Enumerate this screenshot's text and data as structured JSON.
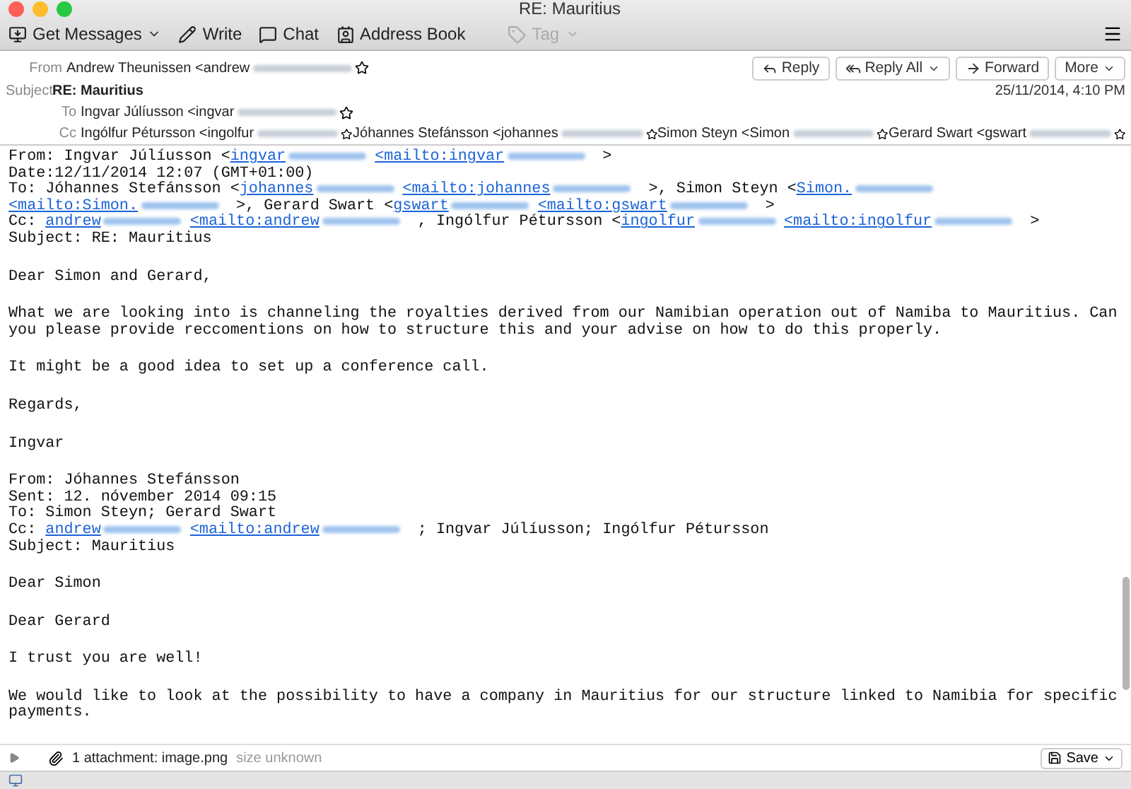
{
  "window": {
    "title": "RE: Mauritius"
  },
  "toolbar": {
    "buttons": [
      {
        "kind": "get",
        "label": "Get Messages",
        "disabled": false
      },
      {
        "kind": "write",
        "label": "Write",
        "disabled": false
      },
      {
        "kind": "chat",
        "label": "Chat",
        "disabled": false
      },
      {
        "kind": "contacts",
        "label": "Address Book",
        "disabled": false
      },
      {
        "kind": "tag",
        "label": "Tag",
        "disabled": true
      }
    ]
  },
  "header": {
    "actions": [
      {
        "kind": "reply",
        "label": "Reply"
      },
      {
        "kind": "replyall",
        "label": "Reply All"
      },
      {
        "kind": "forward",
        "label": "Forward"
      },
      {
        "kind": "more",
        "label": "More"
      }
    ],
    "date": "25/11/2014, 4:10 PM",
    "from": {
      "label": "From",
      "people": [
        {
          "text": "Andrew Theunissen <andrew"
        }
      ]
    },
    "subject": {
      "label": "Subject",
      "value": "RE: Mauritius"
    },
    "to": {
      "label": "To",
      "people": [
        {
          "text": "Ingvar Júlíusson <ingvar"
        }
      ]
    },
    "cc": {
      "label": "Cc",
      "people": [
        {
          "text": "Ingólfur Pétursson <ingolfur"
        },
        {
          "text": "Jóhannes Stefánsson <johannes"
        },
        {
          "text": "Simon Steyn <Simon"
        },
        {
          "text": "Gerard Swart <gswart"
        }
      ]
    }
  },
  "body": [
    {
      "lines": [
        [
          {
            "kind": "text",
            "text": "From: Ingvar Júlíusson <"
          },
          {
            "kind": "link",
            "text": "ingvar"
          },
          {
            "kind": "link",
            "text": "<mailto:ingvar"
          },
          {
            "kind": "text",
            "text": " >"
          }
        ],
        [
          {
            "kind": "text",
            "text": "Date:12/11/2014 12:07 (GMT+01:00)"
          }
        ],
        [
          {
            "kind": "text",
            "text": "To: Jóhannes Stefánsson <"
          },
          {
            "kind": "link",
            "text": "johannes"
          },
          {
            "kind": "link",
            "text": "<mailto:johannes"
          },
          {
            "kind": "text",
            "text": " >, Simon Steyn <"
          },
          {
            "kind": "link",
            "text": "Simon."
          }
        ],
        [
          {
            "kind": "link",
            "text": "<mailto:Simon."
          },
          {
            "kind": "text",
            "text": " >, Gerard Swart <"
          },
          {
            "kind": "link",
            "text": "gswart"
          },
          {
            "kind": "link",
            "text": "<mailto:gswart"
          },
          {
            "kind": "text",
            "text": " >"
          }
        ],
        [
          {
            "kind": "text",
            "text": "Cc: "
          },
          {
            "kind": "link",
            "text": "andrew"
          },
          {
            "kind": "link",
            "text": "<mailto:andrew"
          },
          {
            "kind": "text",
            "text": " , Ingólfur Pétursson <"
          },
          {
            "kind": "link",
            "text": "ingolfur"
          },
          {
            "kind": "link",
            "text": "<mailto:ingolfur"
          },
          {
            "kind": "text",
            "text": " >"
          }
        ],
        [
          {
            "kind": "text",
            "text": "Subject: RE: Mauritius"
          }
        ]
      ]
    },
    {
      "lines": [
        [
          {
            "kind": "text",
            "text": "Dear Simon and Gerard,"
          }
        ]
      ]
    },
    {
      "lines": [
        [
          {
            "kind": "text",
            "text": "What we are looking into is channeling the royalties derived from our Namibian operation out of Namiba to Mauritius. Can you please provide reccomentions on how to structure this and your advise on how to do this properly."
          }
        ]
      ]
    },
    {
      "lines": [
        [
          {
            "kind": "text",
            "text": "It might be a good idea to set up a conference call."
          }
        ]
      ]
    },
    {
      "lines": [
        [
          {
            "kind": "text",
            "text": "Regards,"
          }
        ]
      ]
    },
    {
      "lines": [
        [
          {
            "kind": "text",
            "text": "Ingvar"
          }
        ]
      ]
    },
    {
      "lines": [
        [
          {
            "kind": "text",
            "text": "From: Jóhannes Stefánsson"
          }
        ],
        [
          {
            "kind": "text",
            "text": "Sent: 12. nóvember 2014 09:15"
          }
        ],
        [
          {
            "kind": "text",
            "text": "To: Simon Steyn; Gerard Swart"
          }
        ],
        [
          {
            "kind": "text",
            "text": "Cc: "
          },
          {
            "kind": "link",
            "text": "andrew"
          },
          {
            "kind": "link",
            "text": "<mailto:andrew"
          },
          {
            "kind": "text",
            "text": " ; Ingvar Júlíusson; Ingólfur Pétursson"
          }
        ],
        [
          {
            "kind": "text",
            "text": "Subject: Mauritius"
          }
        ]
      ]
    },
    {
      "lines": [
        [
          {
            "kind": "text",
            "text": "Dear Simon"
          }
        ]
      ]
    },
    {
      "lines": [
        [
          {
            "kind": "text",
            "text": "Dear Gerard"
          }
        ]
      ]
    },
    {
      "lines": [
        [
          {
            "kind": "text",
            "text": "I trust you are well!"
          }
        ]
      ]
    },
    {
      "lines": [
        [
          {
            "kind": "text",
            "text": "We would like to look at the possibility to have a company in Mauritius for our structure linked to Namibia for specific payments."
          }
        ]
      ]
    }
  ],
  "attachments": {
    "summary": "1 attachment: image.png",
    "size": "size unknown",
    "save": "Save"
  }
}
